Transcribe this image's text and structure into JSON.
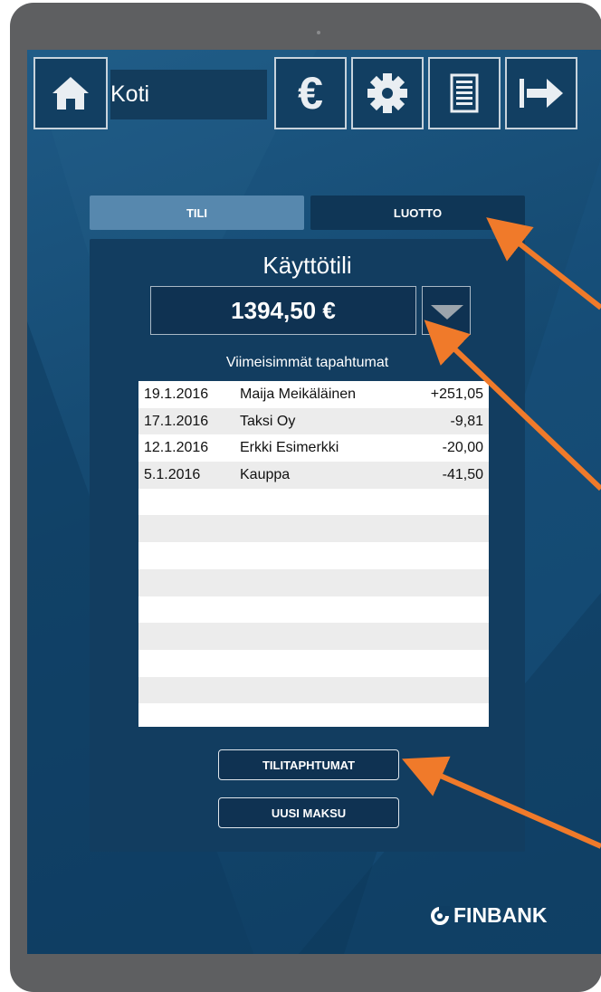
{
  "header": {
    "title": "Koti",
    "icons": [
      "home-icon",
      "euro-icon",
      "gear-icon",
      "document-icon",
      "logout-icon"
    ],
    "euro_symbol": "€"
  },
  "tabs": [
    {
      "label": "TILI",
      "active": true
    },
    {
      "label": "LUOTTO",
      "active": false
    }
  ],
  "account": {
    "name": "Käyttötili",
    "balance": "1394,50 €"
  },
  "transactions": {
    "title": "Viimeisimmät tapahtumat",
    "rows": [
      {
        "date": "19.1.2016",
        "name": "Maija Meikäläinen",
        "amount": "+251,05"
      },
      {
        "date": "17.1.2016",
        "name": "Taksi Oy",
        "amount": "-9,81"
      },
      {
        "date": "12.1.2016",
        "name": "Erkki Esimerkki",
        "amount": "-20,00"
      },
      {
        "date": "5.1.2016",
        "name": "Kauppa",
        "amount": "-41,50"
      }
    ]
  },
  "buttons": {
    "transactions": "TILITAPHTUMAT",
    "new_payment": "UUSI MAKSU"
  },
  "brand": {
    "name": "FINBANK"
  },
  "colors": {
    "accent_arrow": "#f07a2a",
    "screen_bg": "#164a72",
    "active_tab": "#5788ae"
  }
}
